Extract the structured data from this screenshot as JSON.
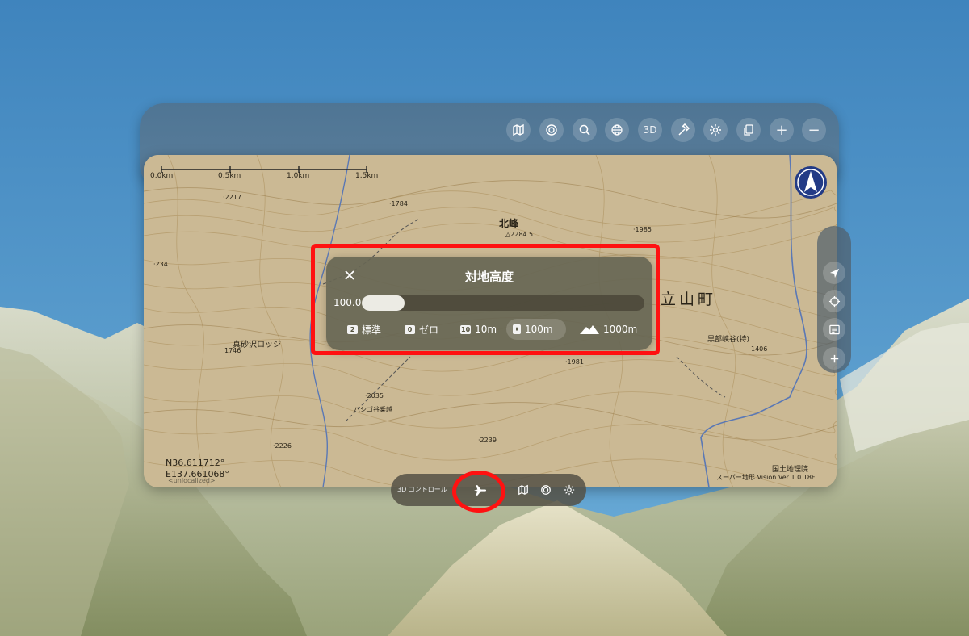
{
  "toolbar": {
    "buttons": [
      {
        "name": "map-icon",
        "label": ""
      },
      {
        "name": "target-icon",
        "label": ""
      },
      {
        "name": "search-icon",
        "label": ""
      },
      {
        "name": "globe-icon",
        "label": ""
      },
      {
        "name": "3d-button",
        "label": "3D"
      },
      {
        "name": "hammer-icon",
        "label": ""
      },
      {
        "name": "gear-icon",
        "label": ""
      },
      {
        "name": "copy-icon",
        "label": ""
      },
      {
        "name": "zoom-in-icon",
        "label": "+"
      },
      {
        "name": "zoom-out-icon",
        "label": "−"
      }
    ]
  },
  "map": {
    "scale_labels": [
      "0.0km",
      "0.5km",
      "1.0km",
      "1.5km"
    ],
    "labels": {
      "peak_name": "北峰",
      "town_name": "立山町",
      "lodge": "真砂沢ロッジ",
      "hut": "ハシゴ谷乗越",
      "gorge": "黒部峡谷(特)",
      "alt_2217": "·2217",
      "alt_1784": "·1784",
      "alt_2284": "△2284.5",
      "alt_1985": "·1985",
      "alt_2341": "·2341",
      "alt_1746": "1746",
      "alt_1406": "1406",
      "alt_1981": "·1981",
      "alt_2035": "·2035",
      "alt_2226": "·2226",
      "alt_2239": "·2239"
    },
    "coords": {
      "lat": "N36.611712°",
      "lon": "E137.661068°"
    },
    "locale_tag": "<unlocalized>",
    "attribution": "国土地理院",
    "version": "スーパー地形 Vision Ver 1.0.18F"
  },
  "altitude_panel": {
    "title": "対地高度",
    "value": "100.0",
    "slider_fraction": 0.15,
    "presets": [
      {
        "icon": "2",
        "label": "標準",
        "selected": false
      },
      {
        "icon": "0",
        "label": "ゼロ",
        "selected": false
      },
      {
        "icon": "10",
        "label": "10m",
        "selected": false
      },
      {
        "icon": "100",
        "label": "100m",
        "selected": true
      },
      {
        "icon": "mountain",
        "label": "1000m",
        "selected": false
      }
    ]
  },
  "side_toolbar": {
    "buttons": [
      "location-arrow-icon",
      "crosshair-icon",
      "list-icon",
      "add-icon"
    ]
  },
  "bottom_bar": {
    "label": "3D コントロール",
    "buttons": [
      "airplane-icon",
      "map-icon",
      "target-icon",
      "gear-icon"
    ]
  },
  "colors": {
    "sky": "#4a8ec4",
    "highlight": "#ff1111",
    "panel": "#676654",
    "toolbar": "#557a98"
  }
}
